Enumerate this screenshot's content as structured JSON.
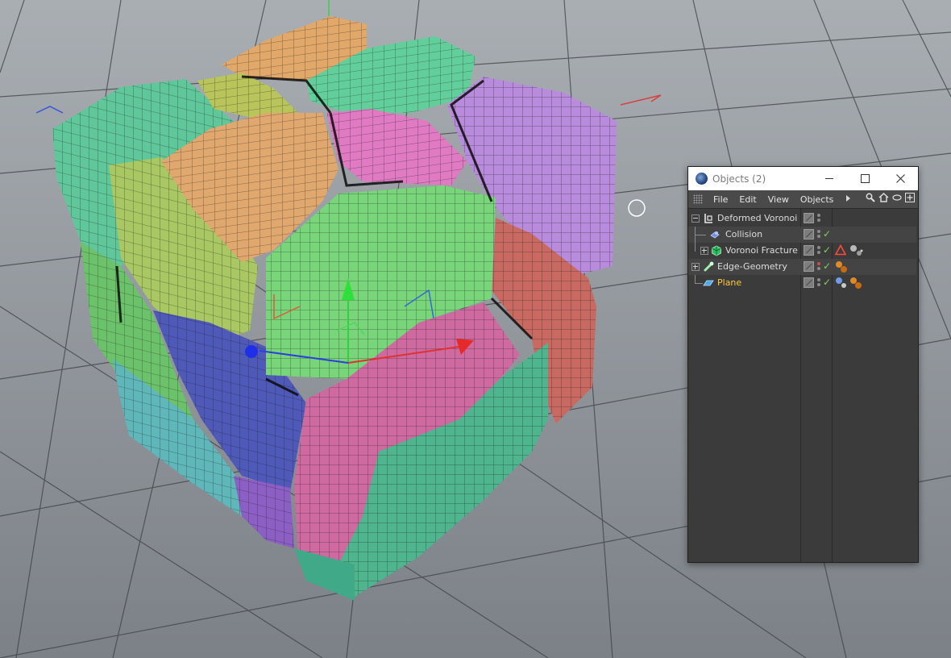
{
  "window": {
    "title": "Objects (2)"
  },
  "menu": [
    "File",
    "Edit",
    "View",
    "Objects"
  ],
  "objects": [
    {
      "name": "Deformed Voronoi",
      "icon": "null-object-icon",
      "expander": "minus",
      "depth": 0,
      "active": false,
      "check": false,
      "dot_top_red": false,
      "dot_bottom_red": false,
      "tags": []
    },
    {
      "name": "Collision",
      "icon": "collision-deformer-icon",
      "expander": "none",
      "depth": 1,
      "active": false,
      "check": true,
      "dot_top_red": false,
      "dot_bottom_red": false,
      "tags": []
    },
    {
      "name": "Voronoi Fracture",
      "icon": "voronoi-fracture-icon",
      "expander": "plus",
      "depth": 1,
      "active": false,
      "check": true,
      "dot_top_red": false,
      "dot_bottom_red": false,
      "tags": [
        "phong-tag-icon",
        "material-tags-icon"
      ]
    },
    {
      "name": "Edge-Geometry",
      "icon": "edge-geometry-icon",
      "expander": "plus",
      "depth": 0,
      "active": false,
      "check": true,
      "dot_top_red": true,
      "dot_bottom_red": false,
      "tags": [
        "material-tag-orange-icon"
      ]
    },
    {
      "name": "Plane",
      "icon": "plane-icon",
      "expander": "none",
      "depth": 0,
      "active": true,
      "check": true,
      "dot_top_red": false,
      "dot_bottom_red": false,
      "tags": [
        "material-tag-blue-icon",
        "material-tag-orange-icon"
      ]
    }
  ],
  "colors": {
    "highlight": "#ffc83a",
    "check": "#7fd35a",
    "window_bg": "#3b3b3b",
    "viewport_bg": "#8d939a"
  }
}
